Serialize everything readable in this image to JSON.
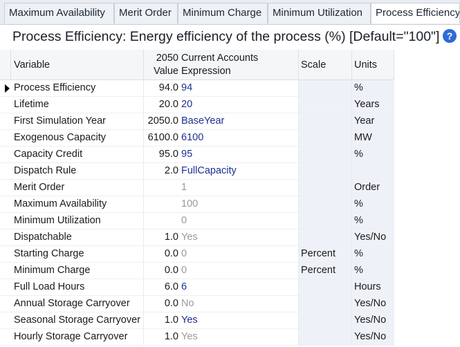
{
  "tabs": [
    {
      "label": "Maximum Availability",
      "active": false
    },
    {
      "label": "Merit Order",
      "active": false
    },
    {
      "label": "Minimum Charge",
      "active": false
    },
    {
      "label": "Minimum Utilization",
      "active": false
    },
    {
      "label": "Process Efficiency",
      "active": true
    }
  ],
  "title": "Process Efficiency: Energy efficiency of the process (%) [Default=\"100\"]",
  "help_icon": "?",
  "columns": {
    "variable": "Variable",
    "value_line1": "2050",
    "value_line2": "Value",
    "expr_line1": "Current Accounts",
    "expr_line2": "Expression",
    "scale": "Scale",
    "units": "Units"
  },
  "rows": [
    {
      "variable": "Process Efficiency",
      "value": "94.0",
      "expression": "94",
      "expr_style": "blue",
      "scale": "",
      "units": "%",
      "selected": true
    },
    {
      "variable": "Lifetime",
      "value": "20.0",
      "expression": "20",
      "expr_style": "blue",
      "scale": "",
      "units": "Years"
    },
    {
      "variable": "First Simulation Year",
      "value": "2050.0",
      "expression": "BaseYear",
      "expr_style": "blue",
      "scale": "",
      "units": "Year"
    },
    {
      "variable": "Exogenous Capacity",
      "value": "6100.0",
      "expression": "6100",
      "expr_style": "blue",
      "scale": "",
      "units": "MW"
    },
    {
      "variable": "Capacity Credit",
      "value": "95.0",
      "expression": "95",
      "expr_style": "blue",
      "scale": "",
      "units": "%"
    },
    {
      "variable": "Dispatch Rule",
      "value": "2.0",
      "expression": "FullCapacity",
      "expr_style": "blue",
      "scale": "",
      "units": ""
    },
    {
      "variable": "Merit Order",
      "value": "",
      "expression": "1",
      "expr_style": "gray",
      "scale": "",
      "units": "Order"
    },
    {
      "variable": "Maximum Availability",
      "value": "",
      "expression": "100",
      "expr_style": "gray",
      "scale": "",
      "units": "%"
    },
    {
      "variable": "Minimum Utilization",
      "value": "",
      "expression": "0",
      "expr_style": "gray",
      "scale": "",
      "units": "%"
    },
    {
      "variable": "Dispatchable",
      "value": "1.0",
      "expression": "Yes",
      "expr_style": "gray",
      "scale": "",
      "units": "Yes/No"
    },
    {
      "variable": "Starting Charge",
      "value": "0.0",
      "expression": "0",
      "expr_style": "gray",
      "scale": "Percent",
      "units": "%"
    },
    {
      "variable": "Minimum Charge",
      "value": "0.0",
      "expression": "0",
      "expr_style": "gray",
      "scale": "Percent",
      "units": "%"
    },
    {
      "variable": "Full Load Hours",
      "value": "6.0",
      "expression": "6",
      "expr_style": "blue",
      "scale": "",
      "units": "Hours"
    },
    {
      "variable": "Annual Storage Carryover",
      "value": "0.0",
      "expression": "No",
      "expr_style": "gray",
      "scale": "",
      "units": "Yes/No"
    },
    {
      "variable": "Seasonal Storage Carryover",
      "value": "1.0",
      "expression": "Yes",
      "expr_style": "blue",
      "scale": "",
      "units": "Yes/No"
    },
    {
      "variable": "Hourly Storage Carryover",
      "value": "1.0",
      "expression": "Yes",
      "expr_style": "gray",
      "scale": "",
      "units": "Yes/No"
    }
  ],
  "colors": {
    "expr_blue": "#1d2f8f",
    "expr_gray": "#9a9a9a",
    "help_blue": "#2f6bd6"
  }
}
